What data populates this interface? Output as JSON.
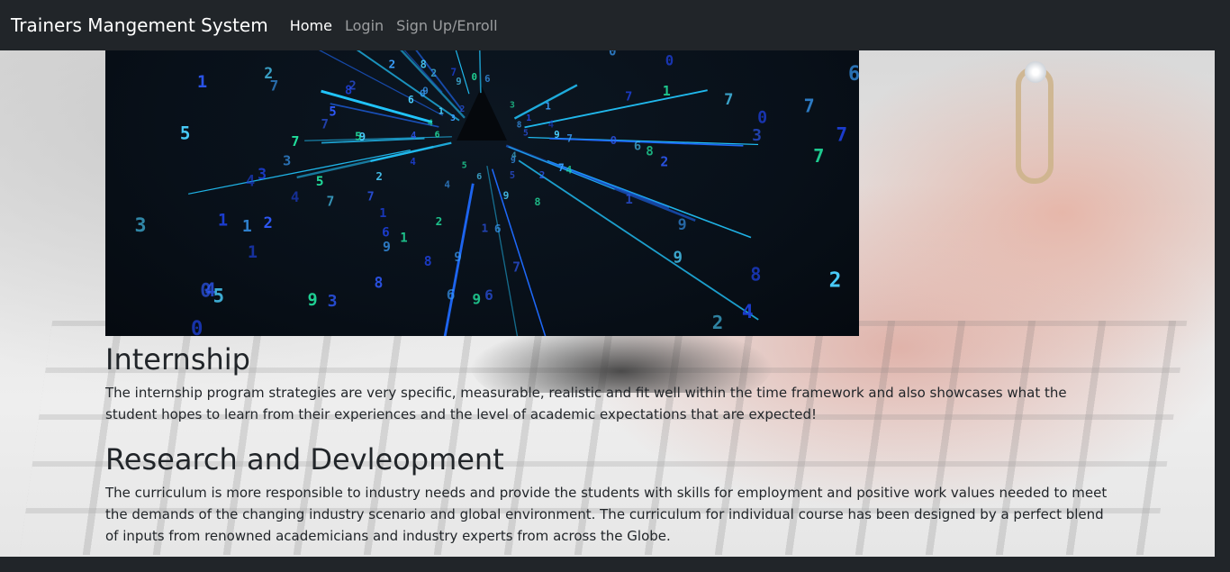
{
  "navbar": {
    "brand": "Trainers Mangement System",
    "links": [
      {
        "label": "Home",
        "active": true
      },
      {
        "label": "Login",
        "active": false
      },
      {
        "label": "Sign Up/Enroll",
        "active": false
      }
    ]
  },
  "hero": {
    "icon": "digital-numbers-tunnel-image"
  },
  "sections": [
    {
      "title": "Internship",
      "text": "The internship program strategies are very specific, measurable, realistic and fit well within the time framework and also showcases what the student hopes to learn from their experiences and the level of academic expectations that are expected!"
    },
    {
      "title": "Research and Devleopment",
      "text": "The curriculum is more responsible to industry needs and provide the students with skills for employment and positive work values needed to meet the demands of the changing industry scenario and global environment. The curriculum for individual course has been designed by a perfect blend of inputs from renowned academicians and industry experts from across the Globe."
    },
    {
      "title": "",
      "text": ""
    }
  ],
  "colors": {
    "navbar_bg": "#212529",
    "nav_active": "#ffffff",
    "nav_inactive": "rgba(255,255,255,0.55)",
    "text": "#212529"
  }
}
